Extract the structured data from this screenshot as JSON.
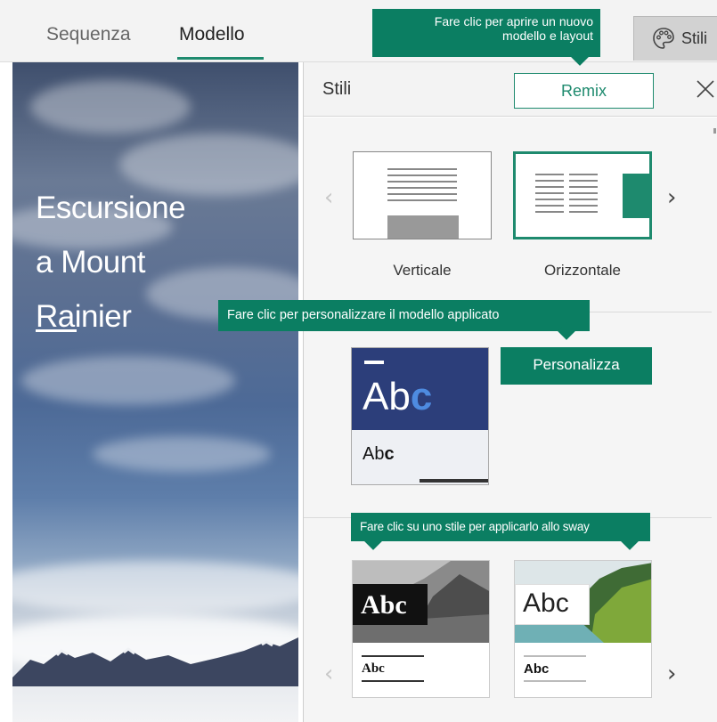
{
  "tabs": [
    {
      "label": "Sequenza"
    },
    {
      "label": "Modello"
    }
  ],
  "top_button": {
    "label": "Stili",
    "icon": "palette-icon"
  },
  "callouts": {
    "open_template": [
      "Fare clic per aprire un nuovo",
      "modello e layout"
    ],
    "customize": "Fare clic per personalizzare il modello applicato",
    "apply_style": "Fare clic su uno stile per applicarlo allo sway"
  },
  "hero": {
    "title_lines": [
      "Escursione",
      "a Mount",
      "Rainier"
    ]
  },
  "panel": {
    "title": "Stili",
    "remix_label": "Remix",
    "close_icon": "close-icon",
    "layouts": [
      {
        "label": "Verticale"
      },
      {
        "label": "Orizzontale",
        "selected": true
      }
    ],
    "customize_label": "Personalizza",
    "theme_card": {
      "big": "Ab",
      "big_accent": "c",
      "small_regular": "Ab",
      "small_bold": "c"
    },
    "style_cards": [
      {
        "big": "Abc",
        "small": "Abc"
      },
      {
        "big": "Abc",
        "small": "Abc"
      }
    ]
  },
  "colors": {
    "accent": "#0b7e62",
    "tab_underline": "#1e8a6e",
    "theme_navy": "#2c3e7a",
    "theme_accent_letter": "#4e8be0"
  }
}
